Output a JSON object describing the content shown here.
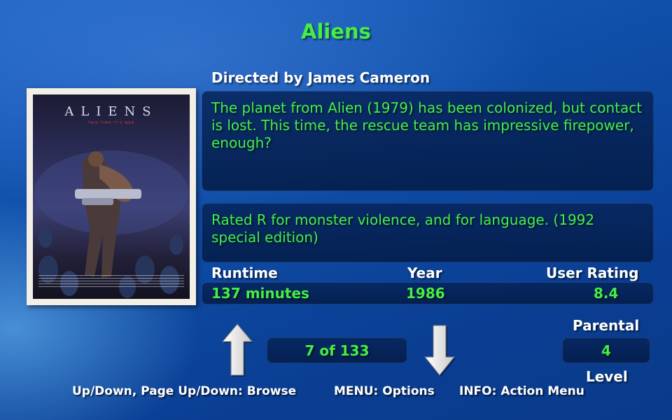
{
  "movie": {
    "title": "Aliens",
    "director_line": "Directed by James Cameron",
    "description": "The planet from Alien (1979) has been colonized, but contact is lost. This time, the rescue team has impressive firepower, enough?",
    "rating_reason": "Rated R for monster violence, and for language. (1992 special edition)",
    "runtime_label": "Runtime",
    "runtime_value": "137 minutes",
    "year_label": "Year",
    "year_value": "1986",
    "user_rating_label": "User Rating",
    "user_rating_value": "8.4",
    "parental_label_top": "Parental",
    "parental_value": "4",
    "parental_label_bottom": "Level"
  },
  "poster": {
    "title_text": "ALIENS",
    "tagline": "THIS TIME IT'S WAR"
  },
  "navigation": {
    "position": "7 of 133",
    "up_icon": "up-arrow-icon",
    "down_icon": "down-arrow-icon"
  },
  "footer": {
    "browse_hint": "Up/Down, Page Up/Down: Browse",
    "menu_hint": "MENU: Options",
    "info_hint": "INFO: Action Menu"
  },
  "colors": {
    "accent_green": "#44ee44",
    "panel": "#062a5e",
    "background": "#0f4ea8"
  }
}
